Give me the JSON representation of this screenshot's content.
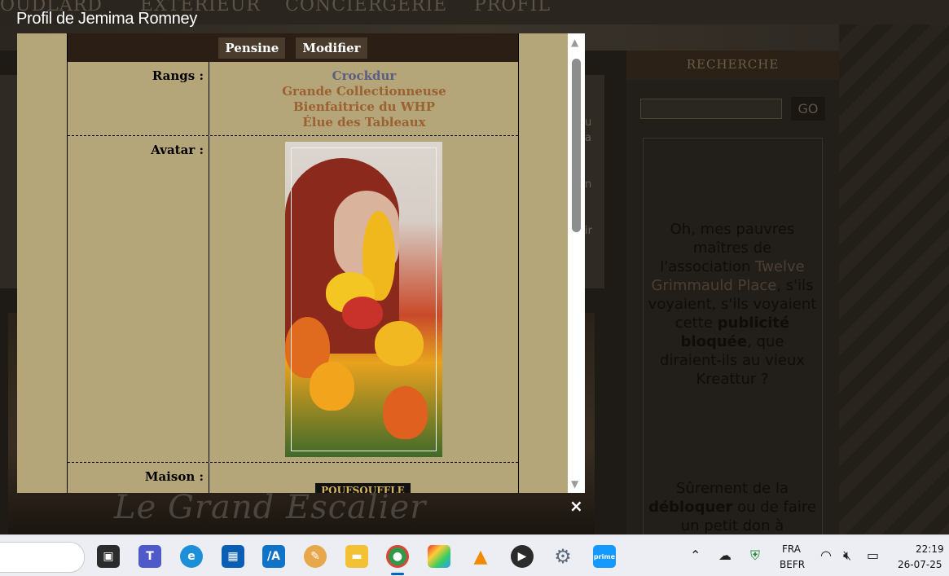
{
  "background": {
    "nav": [
      "OUDLARD",
      "EXTÉRIEUR",
      "CONCIERGERIE",
      "PROFIL"
    ],
    "sidebar_title": "RECHERCHE",
    "go_label": "GO",
    "left_panel_fragments": [
      "u",
      "a",
      "n",
      "ir"
    ],
    "ad_text_1a": "Oh, mes pauvres maîtres de l'association ",
    "ad_link": "Twelve Grimmauld Place",
    "ad_text_1b": ", s'ils voyaient, s'ils voyaient cette ",
    "ad_bold_1": "publicité bloquée",
    "ad_text_1c": ", que diraient-ils au vieux Kreattur ?",
    "ad_text_2a": "Sûrement de la ",
    "ad_bold_2": "débloquer",
    "ad_text_2b": " ou de faire un petit don à",
    "escalier": "Le Grand Escalier"
  },
  "modal": {
    "title": "Profil de Jemima Romney",
    "buttons": {
      "pensine": "Pensine",
      "modifier": "Modifier"
    },
    "labels": {
      "rangs": "Rangs :",
      "avatar": "Avatar :",
      "maison": "Maison :"
    },
    "rangs": [
      {
        "text": "Crockdur",
        "color": "#5a5f82"
      },
      {
        "text": "Grande Collectionneuse",
        "color": "#9a6133"
      },
      {
        "text": "Bienfaitrice du WHP",
        "color": "#9a6133"
      },
      {
        "text": "Élue des Tableaux",
        "color": "#9a6133"
      }
    ],
    "maison_badge": "POUFSOUFFLE",
    "close": "×"
  },
  "taskbar": {
    "lang": "FRA",
    "layout": "BEFR",
    "time": "22:19",
    "date": "26-07-25",
    "apps": [
      "task-view-icon",
      "teams-icon",
      "edge-icon",
      "store-icon",
      "azure-icon",
      "paint-icon",
      "file-explorer-icon",
      "chrome-icon",
      "photos-icon",
      "vlc-icon",
      "media-player-icon",
      "settings-icon",
      "prime-video-icon"
    ]
  }
}
